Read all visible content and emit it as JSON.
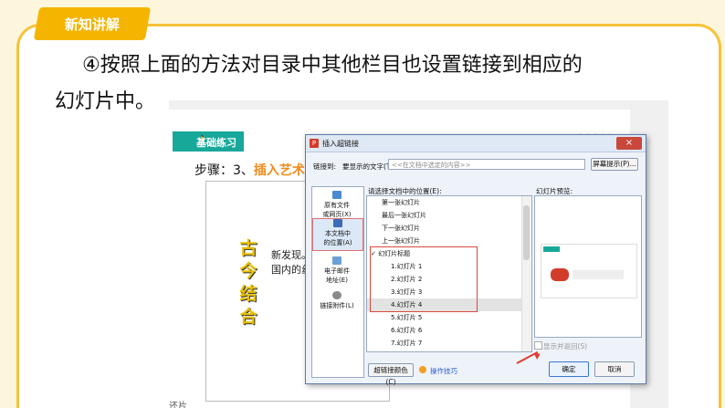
{
  "section_badge": "新知讲解",
  "instruction": {
    "line1": "④按照上面的方法对目录中其他栏目也设置链接到相应的",
    "line2": "幻灯片中。"
  },
  "slide": {
    "exercise_badge": "基础练习",
    "step_prefix": "步骤：3、",
    "step_highlight": "插入艺术",
    "vertical_title": [
      "古",
      "今",
      "结",
      "合"
    ],
    "para_line1": "新发现。",
    "para_line2": "国内的丝",
    "bottom_fragment": "还片"
  },
  "dialog": {
    "title": "插入超链接",
    "close_icon": "×",
    "link_to_label": "链接到:",
    "display_text_label": "要显示的文字(T):",
    "display_text_placeholder": "<<在文档中选定的内容>>",
    "screen_tip_button": "屏幕提示(P)...",
    "nav": [
      {
        "label_1": "原有文件",
        "label_2": "或网页(X)",
        "icon": "globe-icon"
      },
      {
        "label_1": "本文档中",
        "label_2": "的位置(A)",
        "icon": "document-icon"
      },
      {
        "label_1": "电子邮件",
        "label_2": "地址(E)",
        "icon": "email-icon"
      },
      {
        "label_1": "链接附件(L)",
        "label_2": "",
        "icon": "paperclip-icon"
      }
    ],
    "select_location_label": "请选择文档中的位置(E):",
    "list_items": [
      "第一张幻灯片",
      "最后一张幻灯片",
      "下一张幻灯片",
      "上一张幻灯片",
      "✓ 幻灯片标题",
      "1.幻灯片 1",
      "2.幻灯片 2",
      "3.幻灯片 3",
      "4.幻灯片 4",
      "5.幻灯片 5",
      "6.幻灯片 6",
      "7.幻灯片 7"
    ],
    "preview_label": "幻灯片预览:",
    "show_return_label": "显示并返回(S)",
    "hyperlink_color_button": "超链接颜色(C)",
    "tips_link": "操作技巧",
    "ok_button": "确定",
    "cancel_button": "取消"
  }
}
